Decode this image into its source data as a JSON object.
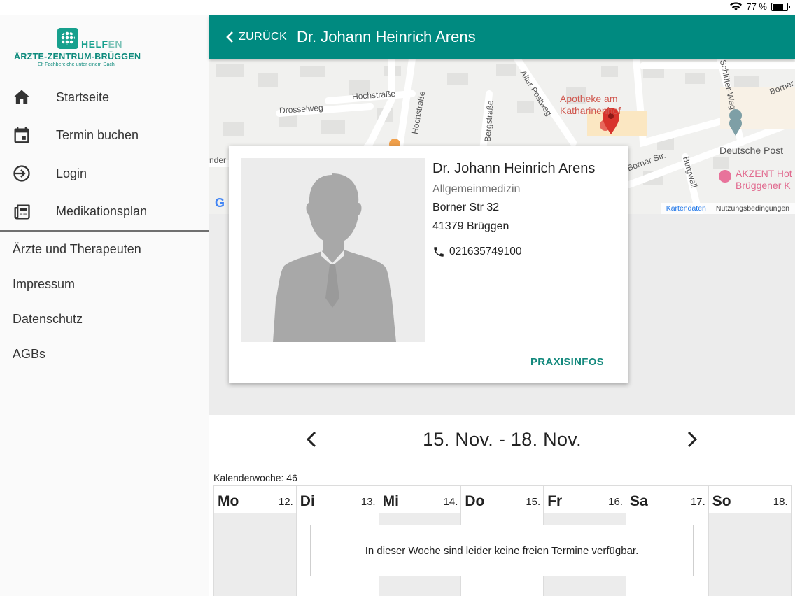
{
  "status": {
    "battery_text": "77 %",
    "battery_level": 0.77,
    "wifi_icon": "wifi-icon"
  },
  "brand": {
    "logo_word_a": "HELF",
    "logo_word_b": "EN",
    "name": "ÄRZTE-ZENTRUM-BRÜGGEN",
    "tagline": "Elf Fachbereiche unter einem Dach"
  },
  "sidebar": {
    "primary": [
      {
        "label": "Startseite",
        "icon": "home-icon"
      },
      {
        "label": "Termin buchen",
        "icon": "calendar-icon"
      },
      {
        "label": "Login",
        "icon": "login-icon"
      },
      {
        "label": "Medikationsplan",
        "icon": "newspaper-icon"
      }
    ],
    "secondary": [
      {
        "label": "Ärzte und Therapeuten"
      },
      {
        "label": "Impressum"
      },
      {
        "label": "Datenschutz"
      },
      {
        "label": "AGBs"
      }
    ]
  },
  "appbar": {
    "back_label": "ZURÜCK",
    "title": "Dr. Johann Heinrich Arens"
  },
  "map": {
    "streets": [
      "Hochstraße",
      "Drosselweg",
      "Hochstraße",
      "Bergstraße",
      "Alter Postweg",
      "Schlüter-Weg",
      "Borner Str.",
      "Burgwall",
      "Borner",
      "nder"
    ],
    "poi_pharmacy": [
      "Apotheke am",
      "Katharinenhof"
    ],
    "poi_post": "Deutsche Post",
    "poi_hotel": [
      "AKZENT Hot",
      "Brüggener K"
    ],
    "footer_data": "Kartendaten",
    "footer_terms": "Nutzungsbedingungen",
    "google_letter": "G",
    "marker_color": "#d8342c"
  },
  "doctor": {
    "name": "Dr. Johann Heinrich Arens",
    "specialty": "Allgemeinmedizin",
    "street": "Borner Str 32",
    "city": "41379 Brüggen",
    "phone": "021635749100",
    "action_label": "PRAXISINFOS"
  },
  "calendar": {
    "range": "15. Nov. - 18. Nov.",
    "week_label": "Kalenderwoche: 46",
    "days": [
      {
        "name": "Mo",
        "num": "12."
      },
      {
        "name": "Di",
        "num": "13."
      },
      {
        "name": "Mi",
        "num": "14."
      },
      {
        "name": "Do",
        "num": "15."
      },
      {
        "name": "Fr",
        "num": "16."
      },
      {
        "name": "Sa",
        "num": "17."
      },
      {
        "name": "So",
        "num": "18."
      }
    ],
    "no_slots_message": "In dieser Woche sind leider keine freien Termine verfügbar."
  },
  "colors": {
    "primary": "#008a80",
    "accent_text": "#14897d"
  }
}
